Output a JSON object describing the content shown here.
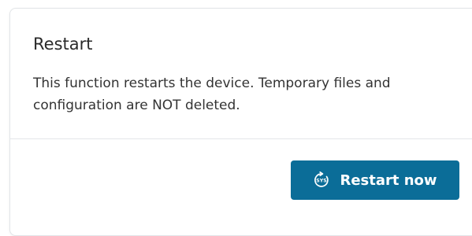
{
  "restart": {
    "title": "Restart",
    "description": "This function restarts the device. Temporary files and configuration are NOT deleted.",
    "button": {
      "label": "Restart now",
      "icon": "restart-sys-icon",
      "icon_text": "SYS"
    }
  },
  "colors": {
    "button_background": "#0b6d98",
    "button_text": "#ffffff"
  }
}
